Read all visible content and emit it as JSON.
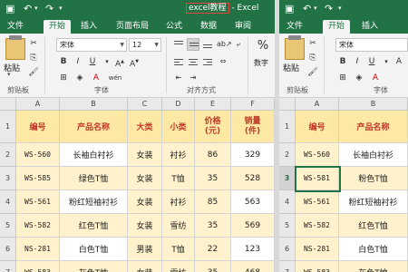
{
  "window": {
    "title": "excel教程 - Excel",
    "title_boxed": "excel教程",
    "title_rest": " - Excel"
  },
  "quick_access": {
    "save_icon": "save-icon",
    "undo_icon": "undo-icon",
    "redo_icon": "redo-icon"
  },
  "tabs": [
    "文件",
    "开始",
    "插入",
    "页面布局",
    "公式",
    "数据",
    "审阅"
  ],
  "tabs_right": [
    "文件",
    "开始",
    "插入"
  ],
  "active_tab": "开始",
  "ribbon": {
    "clipboard": {
      "paste_label": "粘贴",
      "group_label": "剪贴板"
    },
    "font": {
      "font_name": "宋体",
      "font_size": "12",
      "bold": "B",
      "italic": "I",
      "underline": "U",
      "font_color": "A",
      "wen": "wén",
      "group_label": "字体"
    },
    "alignment": {
      "group_label": "对齐方式"
    },
    "number": {
      "percent": "%",
      "label": "数字",
      "group_label": "数字"
    }
  },
  "columns_left": [
    "A",
    "B",
    "C",
    "D",
    "E",
    "F"
  ],
  "columns_right": [
    "A",
    "B",
    ""
  ],
  "table": {
    "headers": [
      "编号",
      "产品名称",
      "大类",
      "小类",
      "价格\n(元)",
      "销量\n(件)"
    ],
    "rows": [
      [
        "WS-560",
        "长袖白衬衫",
        "女装",
        "衬衫",
        "86",
        "329"
      ],
      [
        "WS-585",
        "绿色T恤",
        "女装",
        "T恤",
        "35",
        "528"
      ],
      [
        "WS-561",
        "粉红短袖衬衫",
        "女装",
        "衬衫",
        "85",
        "563"
      ],
      [
        "WS-582",
        "红色T恤",
        "女装",
        "雪纺",
        "35",
        "569"
      ],
      [
        "NS-281",
        "白色T恤",
        "男装",
        "T恤",
        "22",
        "123"
      ],
      [
        "WS-583",
        "灰色T恤",
        "女装",
        "雪纺",
        "35",
        "468"
      ]
    ]
  },
  "right_table": {
    "headers": [
      "编号",
      "产品名称",
      ""
    ],
    "rows": [
      [
        "WS-560",
        "长袖白衬衫",
        ""
      ],
      [
        "WS-581",
        "粉色T恤",
        ""
      ],
      [
        "WS-561",
        "粉红短袖衬衫",
        ""
      ],
      [
        "WS-582",
        "红色T恤",
        ""
      ],
      [
        "NS-281",
        "白色T恤",
        ""
      ],
      [
        "WS-583",
        "灰色T恤",
        ""
      ]
    ]
  },
  "row_numbers": [
    "1",
    "2",
    "3",
    "4",
    "5",
    "6",
    "7"
  ],
  "colors": {
    "excel_green": "#217346",
    "header_fill": "#fde8a4",
    "header_text": "#c0392b",
    "row_fill": "#fff2cc",
    "title_box": "#e8453c"
  }
}
